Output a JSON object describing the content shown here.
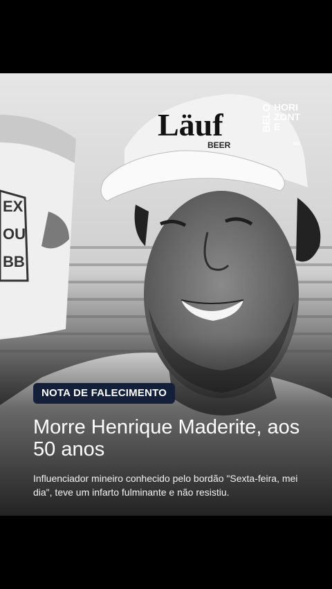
{
  "post": {
    "logo": {
      "line1": "BELO",
      "line2": "HORIZONTE",
      "state": "MG"
    },
    "photo": {
      "cap_text": "Läuf",
      "cap_subtext": "BEER",
      "cup_text": "EX OU BB"
    },
    "badge": "NOTA DE FALECIMENTO",
    "headline": "Morre Henrique Maderite, aos 50 anos",
    "subtitle": "Influenciador mineiro conhecido pelo bordão \"Sexta-feira, mei dia\", teve um infarto fulminante e não resistiu."
  }
}
